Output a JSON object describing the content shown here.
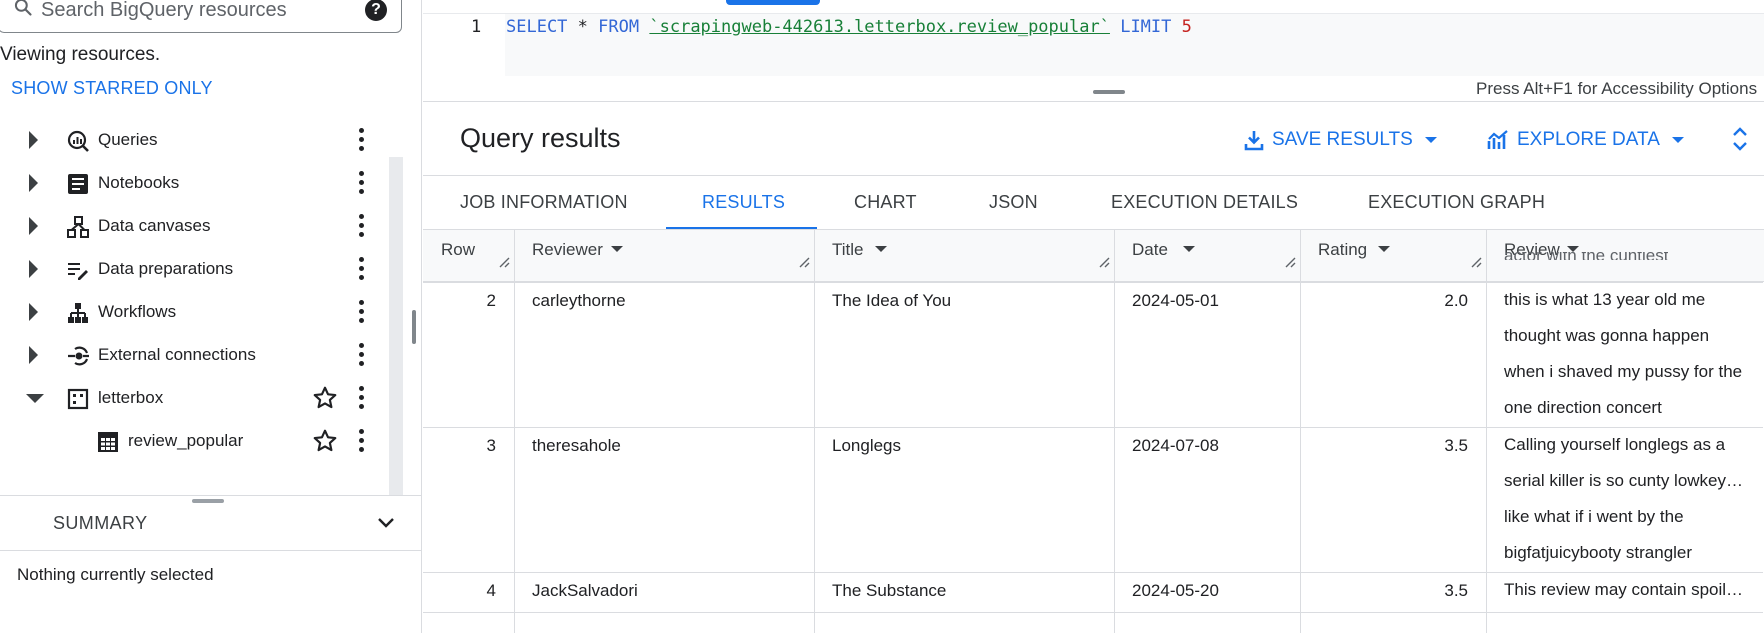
{
  "left_panel": {
    "search_placeholder": "Search BigQuery resources",
    "viewing_text": "Viewing resources.",
    "show_starred_label": "SHOW STARRED ONLY",
    "tree": [
      {
        "label": "Queries",
        "icon": "queries-icon"
      },
      {
        "label": "Notebooks",
        "icon": "notebook-icon"
      },
      {
        "label": "Data canvases",
        "icon": "data-canvas-icon"
      },
      {
        "label": "Data preparations",
        "icon": "data-preparation-icon"
      },
      {
        "label": "Workflows",
        "icon": "workflow-icon"
      },
      {
        "label": "External connections",
        "icon": "external-connection-icon"
      },
      {
        "label": "letterbox",
        "icon": "dataset-icon",
        "expanded": true
      },
      {
        "label": "review_popular",
        "icon": "table-icon"
      }
    ],
    "summary_title": "SUMMARY",
    "summary_empty": "Nothing currently selected"
  },
  "editor": {
    "line_number": "1",
    "query": {
      "select": "SELECT",
      "star": "*",
      "from": "FROM",
      "table": "`scrapingweb-442613.letterbox.review_popular`",
      "limit": "LIMIT",
      "limit_value": "5"
    },
    "accessibility_hint": "Press Alt+F1 for Accessibility Options"
  },
  "results": {
    "title": "Query results",
    "save_label": "SAVE RESULTS",
    "explore_label": "EXPLORE DATA",
    "tabs": [
      "JOB INFORMATION",
      "RESULTS",
      "CHART",
      "JSON",
      "EXECUTION DETAILS",
      "EXECUTION GRAPH"
    ],
    "active_tab": "RESULTS",
    "columns": [
      "Row",
      "Reviewer",
      "Title",
      "Date",
      "Rating",
      "Review"
    ],
    "partial_previous_review": "actor with the cuntiest",
    "rows": [
      {
        "row": "2",
        "reviewer": "carleythorne",
        "title": "The Idea of You",
        "date": "2024-05-01",
        "rating": "2.0",
        "review": "this is what 13 year old me thought was gonna happen when i shaved my pussy for the one direction concert"
      },
      {
        "row": "3",
        "reviewer": "theresahole",
        "title": "Longlegs",
        "date": "2024-07-08",
        "rating": "3.5",
        "review": "Calling yourself longlegs as a serial killer is so cunty lowkey… like what if i went by the bigfatjuicybooty strangler"
      },
      {
        "row": "4",
        "reviewer": "JackSalvadori",
        "title": "The Substance",
        "date": "2024-05-20",
        "rating": "3.5",
        "review": "This review may contain spoile…"
      }
    ]
  },
  "colors": {
    "accent": "#1a73e8",
    "keyword": "#3367d6",
    "table_ref": "#188038",
    "number": "#c5221f"
  }
}
